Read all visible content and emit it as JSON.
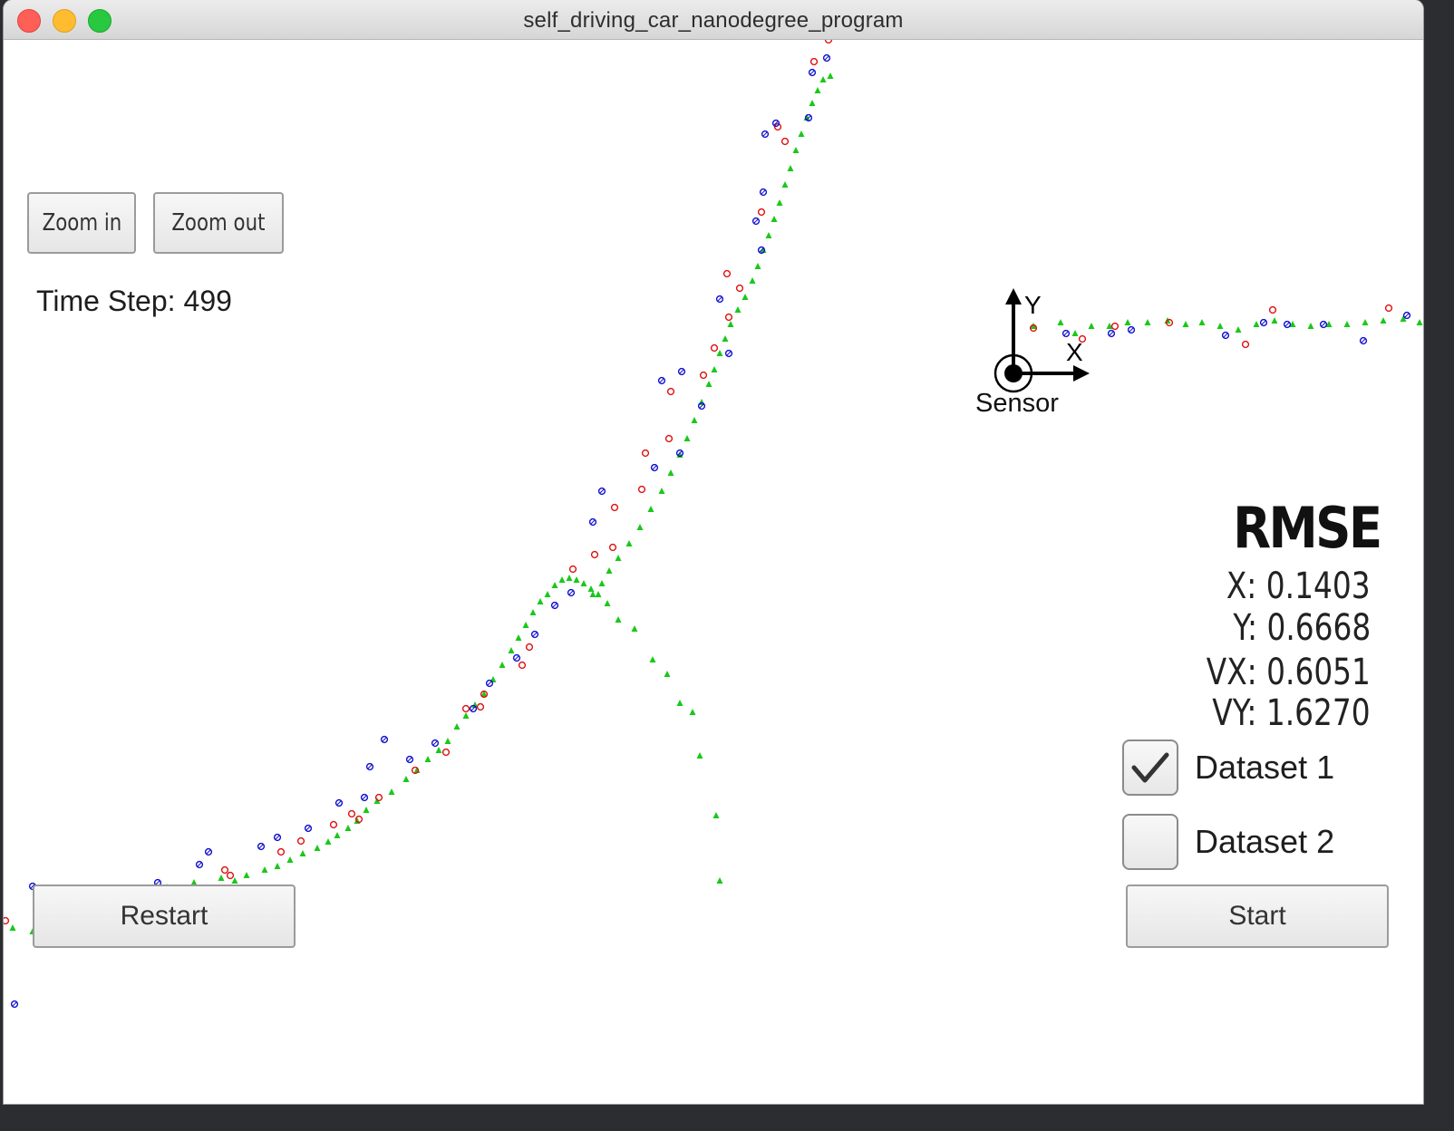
{
  "window": {
    "title": "self_driving_car_nanodegree_program"
  },
  "toolbar": {
    "zoom_in_label": "Zoom in",
    "zoom_out_label": "Zoom out"
  },
  "timestep": {
    "label": "Time Step:",
    "value": "499"
  },
  "sensor": {
    "label": "Sensor",
    "x_axis_label": "X",
    "y_axis_label": "Y"
  },
  "rmse": {
    "title": "RMSE",
    "x": "X: 0.1403",
    "y": "Y: 0.6668",
    "vx": "VX: 0.6051",
    "vy": "VY: 1.6270"
  },
  "datasets": [
    {
      "label": "Dataset 1",
      "checked": true
    },
    {
      "label": "Dataset 2",
      "checked": false
    }
  ],
  "controls": {
    "restart_label": "Restart",
    "start_label": "Start"
  },
  "colors": {
    "ground_truth": "#19c819",
    "radar": "#1010d0",
    "lidar": "#e01010"
  }
}
